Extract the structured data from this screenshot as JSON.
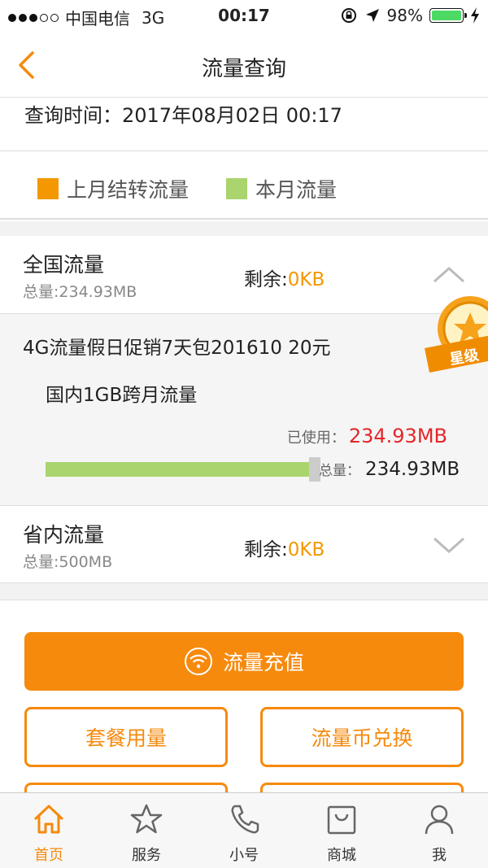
{
  "status_bar": {
    "carrier": "中国电信",
    "network": "3G",
    "time": "00:17",
    "battery": "98%",
    "signal_bars_filled": 3,
    "signal_bars_total": 5
  },
  "nav": {
    "title": "流量查询"
  },
  "query": {
    "label": "查询时间：",
    "value": "2017年08月02日 00:17"
  },
  "legend": [
    {
      "label": "上月结转流量",
      "color": "#f39800"
    },
    {
      "label": "本月流量",
      "color": "#a9d46e"
    }
  ],
  "national": {
    "name": "全国流量",
    "total_label": "总量:",
    "total_value": "234.93MB",
    "remain_label": "剩余:",
    "remain_value": "0KB",
    "expanded": true
  },
  "detail": {
    "package": "4G流量假日促销7天包201610 20元",
    "sub_item": "国内1GB跨月流量",
    "used_label": "已使用：",
    "used_value": "234.93MB",
    "total_label": "总量：",
    "total_value": "234.93MB",
    "usage_fraction": 1.0
  },
  "badge": {
    "text": "星级"
  },
  "province": {
    "name": "省内流量",
    "total_label": "总量:",
    "total_value": "500MB",
    "remain_label": "剩余:",
    "remain_value": "0KB",
    "expanded": false
  },
  "actions": {
    "recharge": "流量充值",
    "plan_usage": "套餐用量",
    "coin_exchange": "流量币兑换"
  },
  "tabs": [
    {
      "label": "首页",
      "icon": "home-icon",
      "active": true
    },
    {
      "label": "服务",
      "icon": "star-icon",
      "active": false
    },
    {
      "label": "小号",
      "icon": "phone-icon",
      "active": false
    },
    {
      "label": "商城",
      "icon": "shopping-bag-icon",
      "active": false
    },
    {
      "label": "我",
      "icon": "user-icon",
      "active": false
    }
  ],
  "colors": {
    "accent": "#f68a0d",
    "used_red": "#e4262a",
    "bar_green": "#a9d46e"
  }
}
